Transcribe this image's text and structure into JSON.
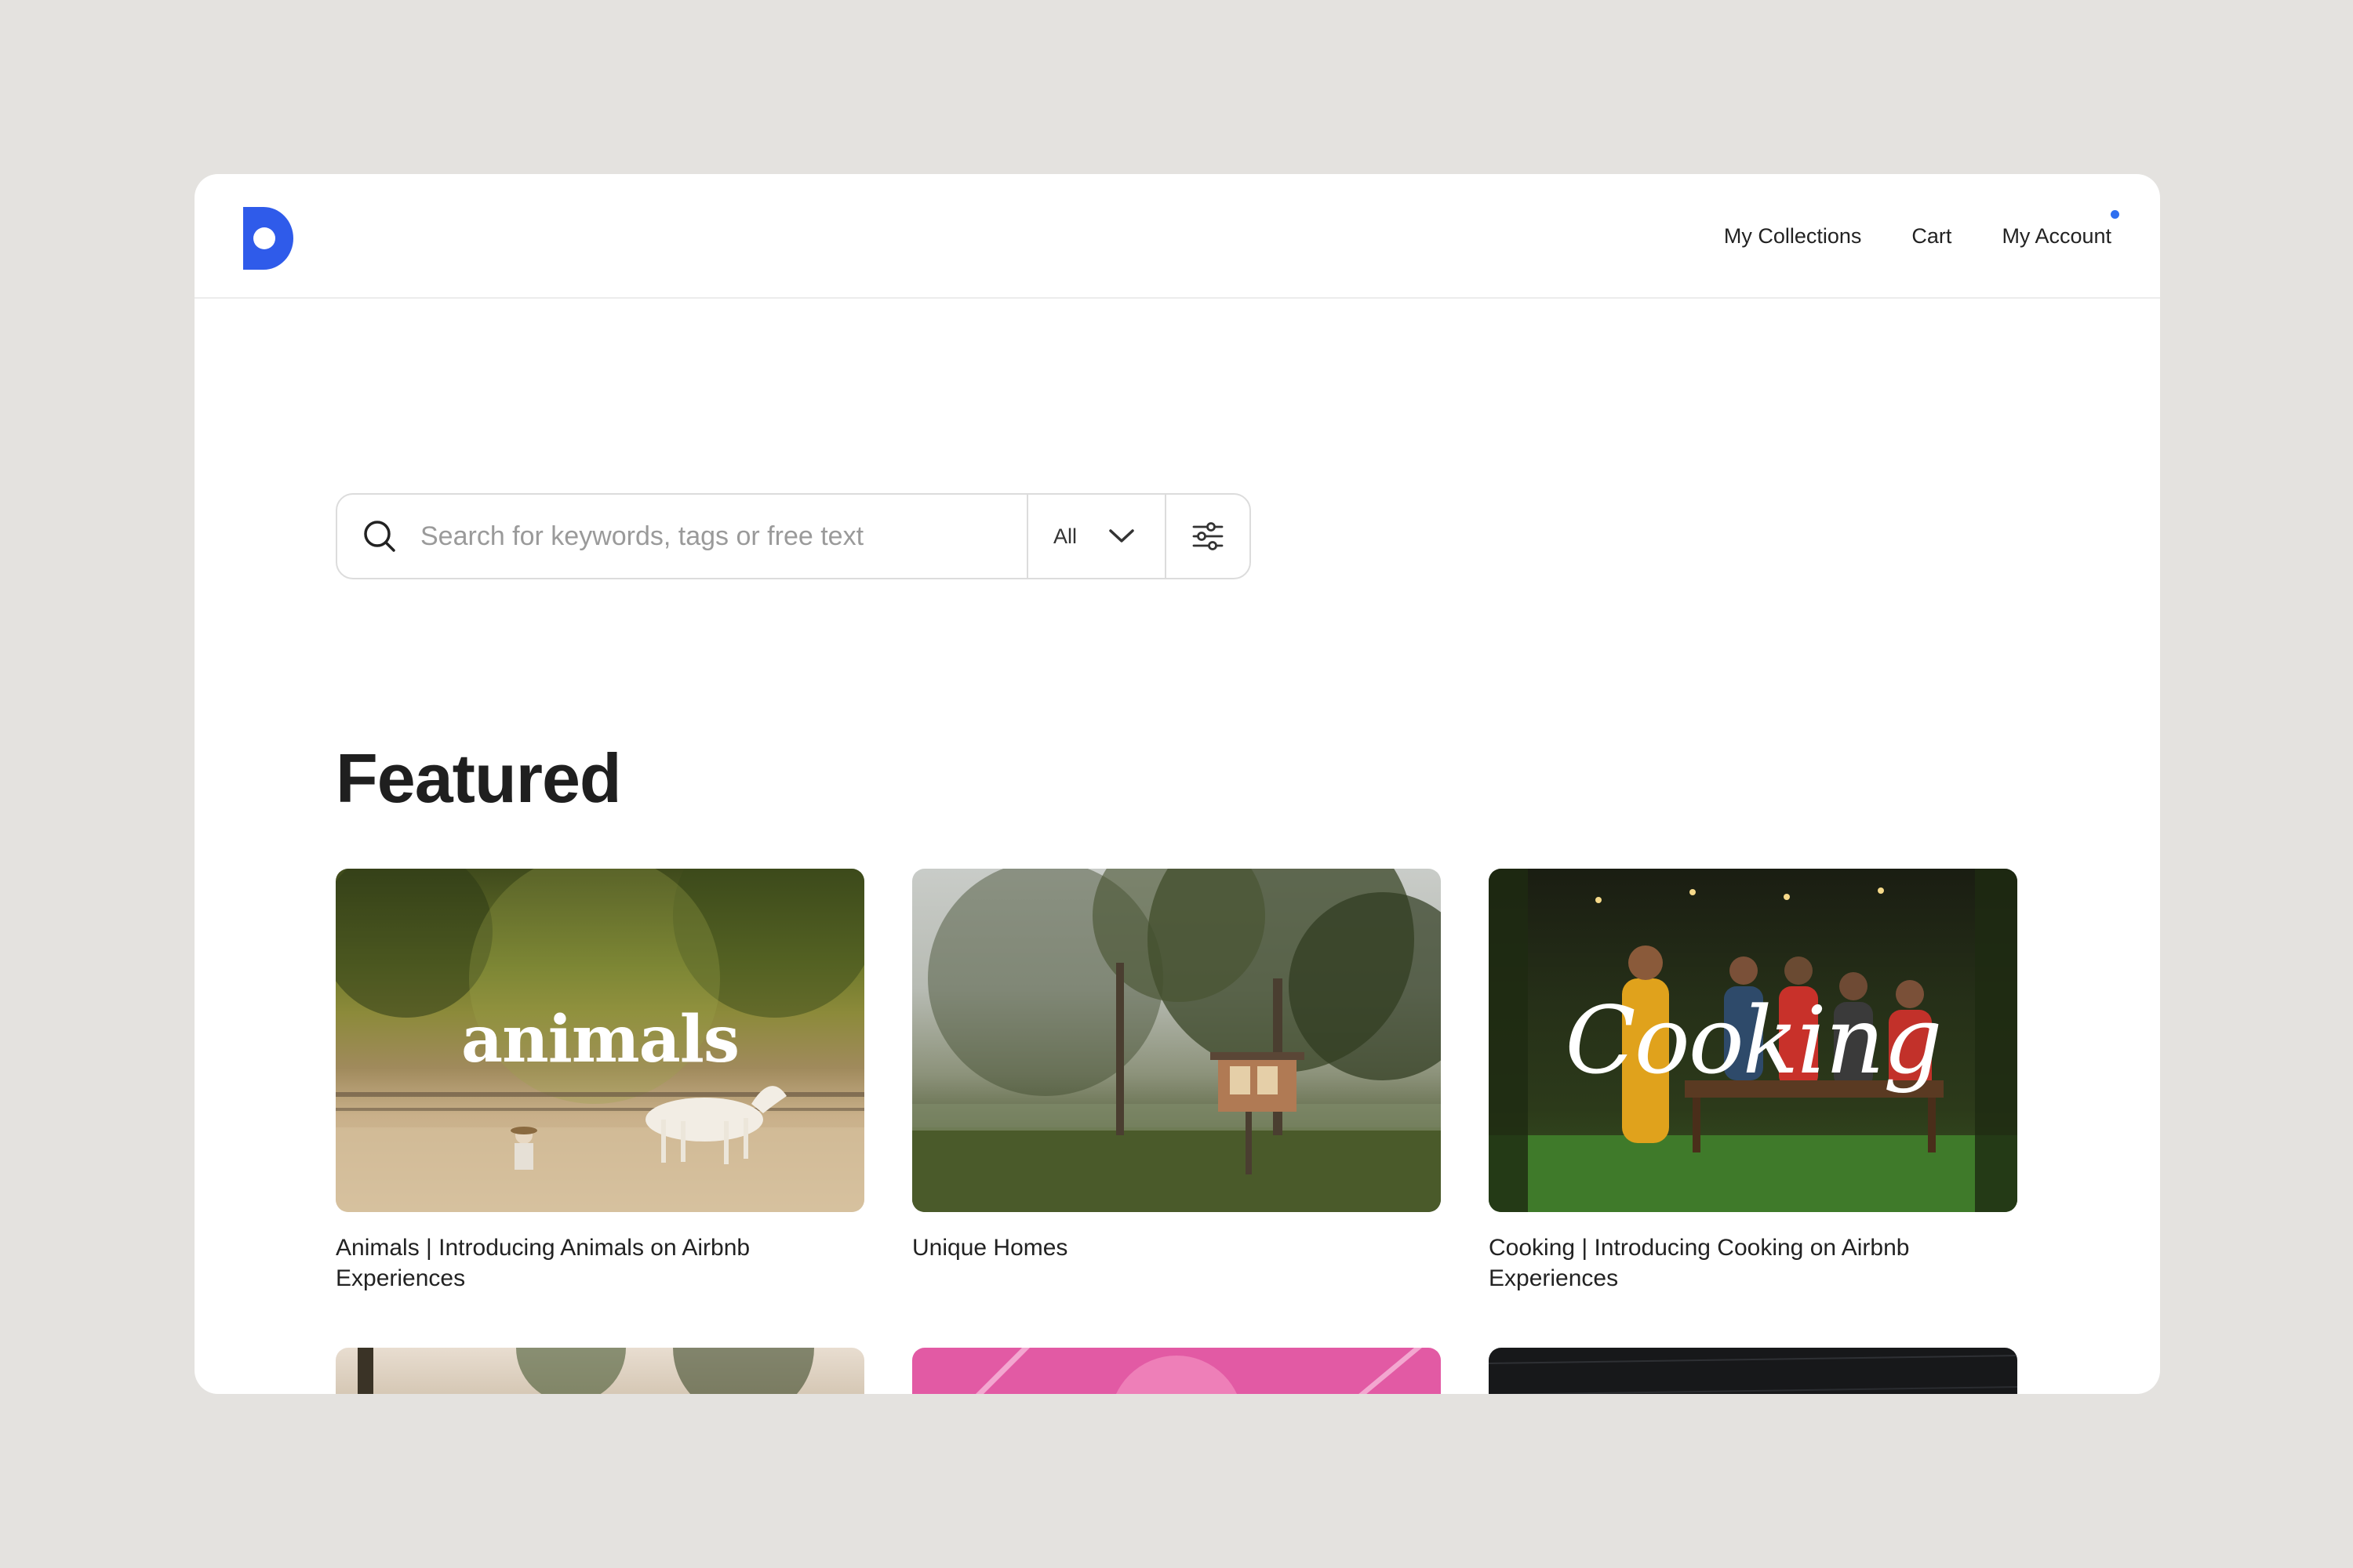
{
  "nav": {
    "collections": "My Collections",
    "cart": "Cart",
    "account": "My Account"
  },
  "colors": {
    "brand": "#2f5bea",
    "notification": "#2f6ff0"
  },
  "search": {
    "placeholder": "Search for keywords, tags or free text",
    "scope": "All"
  },
  "featured": {
    "title": "Featured",
    "cards": [
      {
        "title": "Animals | Introducing Animals on Airbnb Experiences",
        "overlay": "animals"
      },
      {
        "title": "Unique Homes",
        "overlay": ""
      },
      {
        "title": "Cooking | Introducing Cooking on Airbnb Experiences",
        "overlay": "Cooking"
      }
    ]
  },
  "icons": {
    "logo": "brand-d-logo",
    "search": "search-icon",
    "chevron": "chevron-down-icon",
    "filter": "sliders-icon"
  }
}
